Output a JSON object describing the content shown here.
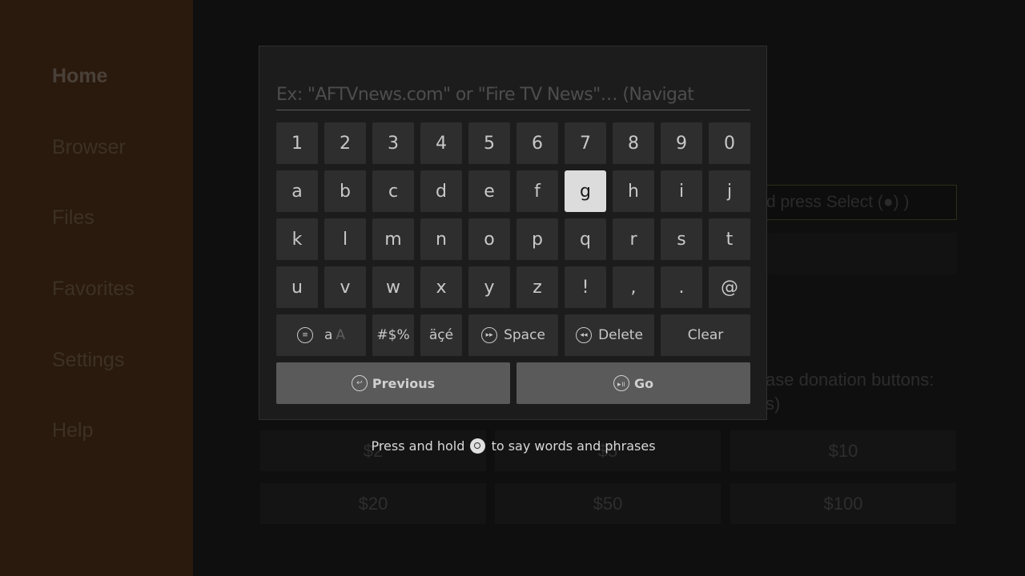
{
  "sidebar": {
    "items": [
      {
        "label": "Home",
        "active": true
      },
      {
        "label": "Browser"
      },
      {
        "label": "Files"
      },
      {
        "label": "Favorites"
      },
      {
        "label": "Settings"
      },
      {
        "label": "Help"
      }
    ]
  },
  "background": {
    "url_field_partial": "d press Select (●) )",
    "donation_text_line1": "ase donation buttons:",
    "donation_text_line2": "s)",
    "donation_buttons": [
      "$2",
      "$5",
      "$10",
      "$20",
      "$50",
      "$100"
    ]
  },
  "keyboard": {
    "search_placeholder": "Ex: \"AFTVnews.com\" or \"Fire TV News\"… (Navigat",
    "rows": [
      [
        "1",
        "2",
        "3",
        "4",
        "5",
        "6",
        "7",
        "8",
        "9",
        "0"
      ],
      [
        "a",
        "b",
        "c",
        "d",
        "e",
        "f",
        "g",
        "h",
        "i",
        "j"
      ],
      [
        "k",
        "l",
        "m",
        "n",
        "o",
        "p",
        "q",
        "r",
        "s",
        "t"
      ],
      [
        "u",
        "v",
        "w",
        "x",
        "y",
        "z",
        "!",
        ",",
        ".",
        "@"
      ]
    ],
    "selected_key": "g",
    "special_keys": {
      "case_lower": "a",
      "case_upper": "A",
      "symbols": "#$%",
      "accents": "äçé",
      "space": "Space",
      "delete": "Delete",
      "clear": "Clear"
    },
    "icons": {
      "case": "≡",
      "space": "▸▸",
      "delete": "◂◂",
      "previous": "↩",
      "go": "▸॥"
    },
    "previous_label": "Previous",
    "go_label": "Go"
  },
  "voice_hint": {
    "before": "Press and hold",
    "after": "to say words and phrases"
  }
}
